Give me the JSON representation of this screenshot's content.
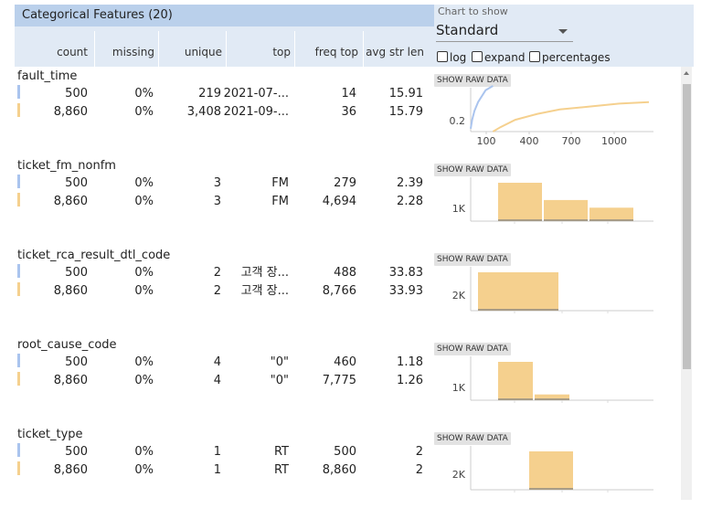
{
  "header": {
    "title": "Categorical Features (20)",
    "columns": [
      "count",
      "missing",
      "unique",
      "top",
      "freq top",
      "avg str len"
    ]
  },
  "controls": {
    "chart_label": "Chart to show",
    "chart_value": "Standard",
    "log_label": "log",
    "expand_label": "expand",
    "percentages_label": "percentages"
  },
  "raw_button_label": "SHOW RAW DATA",
  "colors": {
    "series_a": "#aac4ee",
    "series_b": "#f5d08e",
    "header": "#bad0eb"
  },
  "features": [
    {
      "name": "fault_time",
      "rows": [
        {
          "count": "500",
          "missing": "0%",
          "unique": "219",
          "top": "2021-07-...",
          "freq": "14",
          "avg": "15.91"
        },
        {
          "count": "8,860",
          "missing": "0%",
          "unique": "3,408",
          "top": "2021-09-...",
          "freq": "36",
          "avg": "15.79"
        }
      ],
      "chart": {
        "type": "line",
        "y_tick": "0.2",
        "x_ticks": [
          "100",
          "400",
          "700",
          "1000"
        ],
        "series_a": [
          [
            0,
            0.02
          ],
          [
            10,
            0.08
          ],
          [
            25,
            0.14
          ],
          [
            50,
            0.2
          ],
          [
            100,
            0.28
          ],
          [
            150,
            0.31
          ]
        ],
        "series_b": [
          [
            150,
            0.0
          ],
          [
            200,
            0.03
          ],
          [
            300,
            0.08
          ],
          [
            450,
            0.12
          ],
          [
            600,
            0.15
          ],
          [
            800,
            0.17
          ],
          [
            1000,
            0.19
          ],
          [
            1200,
            0.2
          ]
        ]
      }
    },
    {
      "name": "ticket_fm_nonfm",
      "rows": [
        {
          "count": "500",
          "missing": "0%",
          "unique": "3",
          "top": "FM",
          "freq": "279",
          "avg": "2.39"
        },
        {
          "count": "8,860",
          "missing": "0%",
          "unique": "3",
          "top": "FM",
          "freq": "4,694",
          "avg": "2.28"
        }
      ],
      "chart": {
        "type": "bar",
        "y_tick": "1K",
        "bars": [
          1.0,
          0.55,
          0.35
        ]
      }
    },
    {
      "name": "ticket_rca_result_dtl_code",
      "rows": [
        {
          "count": "500",
          "missing": "0%",
          "unique": "2",
          "top": "고객 장...",
          "freq": "488",
          "avg": "33.83"
        },
        {
          "count": "8,860",
          "missing": "0%",
          "unique": "2",
          "top": "고객 장...",
          "freq": "8,766",
          "avg": "33.93"
        }
      ],
      "chart": {
        "type": "bar",
        "y_tick": "2K",
        "bars": [
          1.0
        ]
      }
    },
    {
      "name": "root_cause_code",
      "rows": [
        {
          "count": "500",
          "missing": "0%",
          "unique": "4",
          "top": "\"0\"",
          "freq": "460",
          "avg": "1.18"
        },
        {
          "count": "8,860",
          "missing": "0%",
          "unique": "4",
          "top": "\"0\"",
          "freq": "7,775",
          "avg": "1.26"
        }
      ],
      "chart": {
        "type": "bar",
        "y_tick": "1K",
        "bars": [
          1.0,
          0.15
        ]
      }
    },
    {
      "name": "ticket_type",
      "rows": [
        {
          "count": "500",
          "missing": "0%",
          "unique": "1",
          "top": "RT",
          "freq": "500",
          "avg": "2"
        },
        {
          "count": "8,860",
          "missing": "0%",
          "unique": "1",
          "top": "RT",
          "freq": "8,860",
          "avg": "2"
        }
      ],
      "chart": {
        "type": "bar",
        "y_tick": "2K",
        "bars": [
          1.0
        ],
        "offset": 1
      }
    }
  ]
}
